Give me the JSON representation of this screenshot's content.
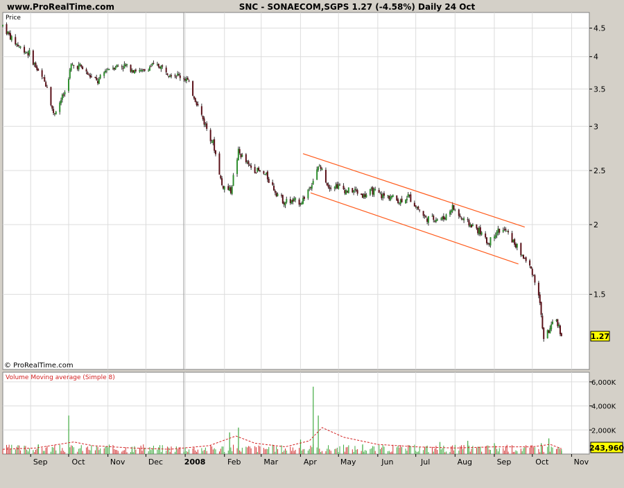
{
  "header": {
    "site": "www.ProRealTime.com",
    "title": "SNC - SONAECOM,SGPS    1.27 (-4.58%)    Daily  24 Oct"
  },
  "price_panel": {
    "label": "Price",
    "copyright": "© ProRealTime.com",
    "last_price_badge": "1.27"
  },
  "volume_panel": {
    "label": "Volume Moving average (Simple 8)",
    "last_volume_badge": "243,960"
  },
  "colors": {
    "background": "#d4d0c8",
    "plot_bg": "#ffffff",
    "candle_up": "#2f8f2f",
    "candle_down": "#5a1018",
    "channel": "#ff5a1a",
    "volume_ma": "#d21f1f",
    "volume_up": "#3faa3f",
    "volume_down": "#d23030",
    "grid": "#dcdcdc"
  },
  "chart_data": [
    {
      "type": "candlestick",
      "scale": "log",
      "ylabel": "Price",
      "ylim": [
        1.1,
        4.8
      ],
      "yticks": [
        1.5,
        2,
        2.5,
        3,
        3.5,
        4,
        4.5
      ],
      "ytick_labels": [
        "1.5",
        "2",
        "2.5",
        "3",
        "3.5",
        "4",
        "4.5"
      ],
      "x_axis_labels": [
        "Sep",
        "Oct",
        "Nov",
        "Dec",
        "2008",
        "Feb",
        "Mar",
        "Apr",
        "May",
        "Jun",
        "Jul",
        "Aug",
        "Sep",
        "Oct",
        "Nov"
      ],
      "x_axis_dates": [
        "2007-09-01",
        "2007-10-01",
        "2007-11-01",
        "2007-12-01",
        "2008-01-01",
        "2008-02-01",
        "2008-03-01",
        "2008-04-01",
        "2008-05-01",
        "2008-06-01",
        "2008-07-01",
        "2008-08-01",
        "2008-09-01",
        "2008-10-01",
        "2008-11-01"
      ],
      "xlim": [
        "2007-08-10",
        "2008-11-15"
      ],
      "series_close": [
        [
          "2007-08-10",
          4.55
        ],
        [
          "2007-08-17",
          4.3
        ],
        [
          "2007-08-24",
          4.15
        ],
        [
          "2007-08-31",
          4.05
        ],
        [
          "2007-09-07",
          3.75
        ],
        [
          "2007-09-14",
          3.55
        ],
        [
          "2007-09-19",
          3.15
        ],
        [
          "2007-09-28",
          3.45
        ],
        [
          "2007-10-03",
          3.85
        ],
        [
          "2007-10-10",
          3.85
        ],
        [
          "2007-10-17",
          3.7
        ],
        [
          "2007-10-24",
          3.6
        ],
        [
          "2007-10-31",
          3.8
        ],
        [
          "2007-11-07",
          3.85
        ],
        [
          "2007-11-14",
          3.85
        ],
        [
          "2007-11-21",
          3.8
        ],
        [
          "2007-11-28",
          3.75
        ],
        [
          "2007-12-05",
          3.85
        ],
        [
          "2007-12-12",
          3.85
        ],
        [
          "2007-12-19",
          3.75
        ],
        [
          "2008-01-02",
          3.65
        ],
        [
          "2008-01-09",
          3.35
        ],
        [
          "2008-01-16",
          3.05
        ],
        [
          "2008-01-23",
          2.8
        ],
        [
          "2008-01-30",
          2.35
        ],
        [
          "2008-02-06",
          2.3
        ],
        [
          "2008-02-12",
          2.7
        ],
        [
          "2008-02-20",
          2.55
        ],
        [
          "2008-02-27",
          2.5
        ],
        [
          "2008-03-05",
          2.45
        ],
        [
          "2008-03-12",
          2.3
        ],
        [
          "2008-03-19",
          2.2
        ],
        [
          "2008-03-26",
          2.2
        ],
        [
          "2008-04-02",
          2.2
        ],
        [
          "2008-04-09",
          2.35
        ],
        [
          "2008-04-16",
          2.55
        ],
        [
          "2008-04-23",
          2.35
        ],
        [
          "2008-04-30",
          2.35
        ],
        [
          "2008-05-07",
          2.3
        ],
        [
          "2008-05-14",
          2.3
        ],
        [
          "2008-05-21",
          2.25
        ],
        [
          "2008-05-28",
          2.3
        ],
        [
          "2008-06-04",
          2.25
        ],
        [
          "2008-06-11",
          2.25
        ],
        [
          "2008-06-18",
          2.2
        ],
        [
          "2008-06-25",
          2.25
        ],
        [
          "2008-07-02",
          2.15
        ],
        [
          "2008-07-09",
          2.05
        ],
        [
          "2008-07-16",
          2.05
        ],
        [
          "2008-07-23",
          2.05
        ],
        [
          "2008-07-30",
          2.15
        ],
        [
          "2008-08-06",
          2.05
        ],
        [
          "2008-08-13",
          2.0
        ],
        [
          "2008-08-20",
          1.95
        ],
        [
          "2008-08-27",
          1.85
        ],
        [
          "2008-09-03",
          1.95
        ],
        [
          "2008-09-10",
          1.95
        ],
        [
          "2008-09-17",
          1.85
        ],
        [
          "2008-09-24",
          1.75
        ],
        [
          "2008-10-01",
          1.65
        ],
        [
          "2008-10-06",
          1.5
        ],
        [
          "2008-10-10",
          1.25
        ],
        [
          "2008-10-15",
          1.3
        ],
        [
          "2008-10-20",
          1.35
        ],
        [
          "2008-10-24",
          1.27
        ]
      ],
      "channel_lines": [
        [
          [
            "2008-04-03",
            2.68
          ],
          [
            "2008-09-25",
            1.98
          ]
        ],
        [
          [
            "2008-04-09",
            2.28
          ],
          [
            "2008-09-20",
            1.7
          ]
        ]
      ]
    },
    {
      "type": "bar",
      "title": "Volume Moving average (Simple 8)",
      "ylim": [
        0,
        6800000
      ],
      "yticks": [
        2000000,
        4000000,
        6000000
      ],
      "ytick_labels": [
        "2,000K",
        "4,000K",
        "6,000K"
      ],
      "spikes": [
        [
          "2007-09-07",
          800000
        ],
        [
          "2007-10-01",
          3200000
        ],
        [
          "2007-11-20",
          600000
        ],
        [
          "2008-02-05",
          1800000
        ],
        [
          "2008-02-12",
          2200000
        ],
        [
          "2008-04-01",
          1200000
        ],
        [
          "2008-04-11",
          5600000
        ],
        [
          "2008-04-15",
          3200000
        ],
        [
          "2008-05-20",
          800000
        ],
        [
          "2008-07-20",
          1000000
        ],
        [
          "2008-08-11",
          1100000
        ],
        [
          "2008-09-01",
          900000
        ],
        [
          "2008-10-08",
          900000
        ],
        [
          "2008-10-14",
          1300000
        ],
        [
          "2008-10-24",
          243960
        ]
      ],
      "ma_line": [
        [
          "2007-08-10",
          400000
        ],
        [
          "2007-09-05",
          500000
        ],
        [
          "2007-10-05",
          1000000
        ],
        [
          "2007-10-20",
          700000
        ],
        [
          "2007-11-20",
          500000
        ],
        [
          "2007-12-20",
          400000
        ],
        [
          "2008-01-20",
          700000
        ],
        [
          "2008-02-10",
          1500000
        ],
        [
          "2008-02-25",
          900000
        ],
        [
          "2008-03-20",
          600000
        ],
        [
          "2008-04-08",
          1100000
        ],
        [
          "2008-04-18",
          2200000
        ],
        [
          "2008-05-05",
          1400000
        ],
        [
          "2008-06-01",
          800000
        ],
        [
          "2008-07-01",
          600000
        ],
        [
          "2008-08-01",
          500000
        ],
        [
          "2008-09-01",
          600000
        ],
        [
          "2008-10-01",
          600000
        ],
        [
          "2008-10-15",
          800000
        ],
        [
          "2008-10-24",
          450000
        ]
      ]
    }
  ]
}
